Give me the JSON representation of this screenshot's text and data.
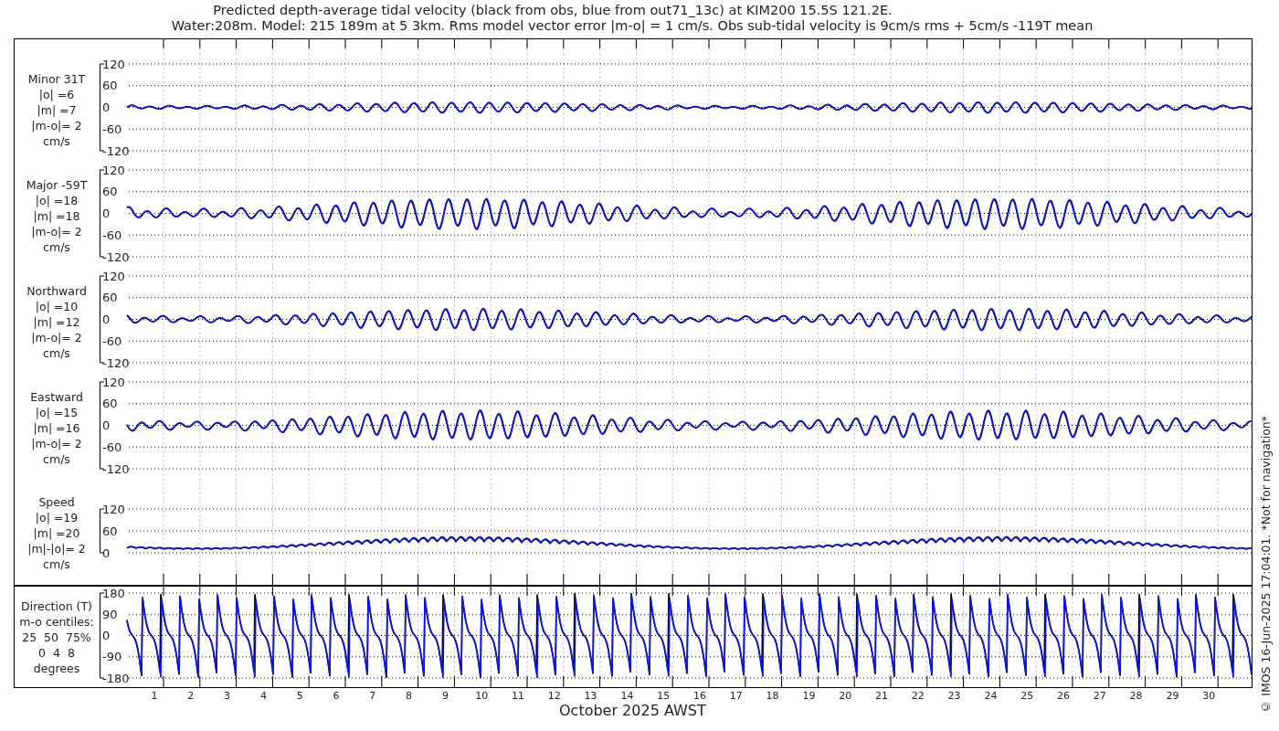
{
  "title": {
    "lines": [
      "Predicted depth-average tidal velocity (black from obs, blue from out71_13c) at KIM200 15.5S 121.2E.",
      "Water:208m. Model: 215 189m at 5 3km. Rms model vector error |m-o| = 1 cm/s. Obs sub-tidal velocity is 9cm/s rms + 5cm/s -119T mean"
    ]
  },
  "panels": [
    {
      "kind": "component",
      "label_lines": [
        "Minor 31T",
        "|o| =6",
        "|m| =7",
        "|m-o|= 2",
        "cm/s"
      ],
      "yticks": [
        "120",
        "60",
        "0",
        "-60",
        "-120"
      ]
    },
    {
      "kind": "component",
      "label_lines": [
        "Major -59T",
        "|o| =18",
        "|m| =18",
        "|m-o|= 2",
        "cm/s"
      ],
      "yticks": [
        "120",
        "60",
        "0",
        "-60",
        "-120"
      ]
    },
    {
      "kind": "component",
      "label_lines": [
        "Northward",
        "|o| =10",
        "|m| =12",
        "|m-o|= 2",
        "cm/s"
      ],
      "yticks": [
        "120",
        "60",
        "0",
        "-60",
        "-120"
      ]
    },
    {
      "kind": "component",
      "label_lines": [
        "Eastward",
        "|o| =15",
        "|m| =16",
        "|m-o|= 2",
        "cm/s"
      ],
      "yticks": [
        "120",
        "60",
        "0",
        "-60",
        "-120"
      ]
    },
    {
      "kind": "speed",
      "label_lines": [
        "Speed",
        "|o| =19",
        "|m| =20",
        "|m|-|o|= 2",
        "cm/s"
      ],
      "yticks": [
        "120",
        "60",
        "0"
      ]
    },
    {
      "kind": "direction",
      "label_lines": [
        "Direction (T)",
        "m-o centiles:",
        "25  50  75%",
        "0  4  8",
        "degrees"
      ],
      "yticks": [
        "180",
        "90",
        "0",
        "-90",
        "-180"
      ]
    }
  ],
  "x_axis": {
    "ticks": [
      "1",
      "2",
      "3",
      "4",
      "5",
      "6",
      "7",
      "8",
      "9",
      "10",
      "11",
      "12",
      "13",
      "14",
      "15",
      "16",
      "17",
      "18",
      "19",
      "20",
      "21",
      "22",
      "23",
      "24",
      "25",
      "26",
      "27",
      "28",
      "29",
      "30"
    ],
    "title": "October 2025 AWST"
  },
  "footnote": "© IMOS 16-Jun-2025 17:04:01. *Not for navigation*"
}
